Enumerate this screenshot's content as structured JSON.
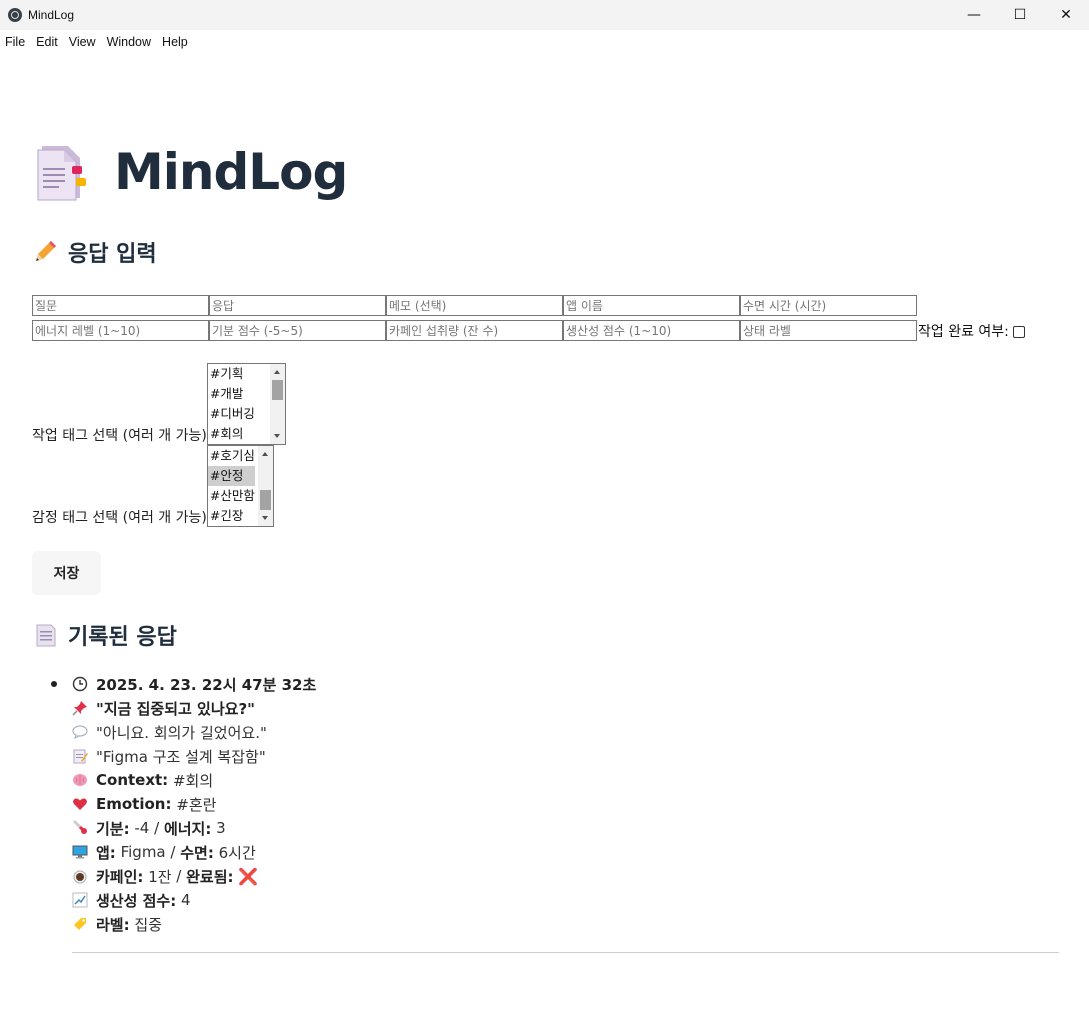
{
  "window": {
    "title": "MindLog",
    "min_glyph": "—",
    "max_glyph": "☐",
    "close_glyph": "✕"
  },
  "menu": [
    "File",
    "Edit",
    "View",
    "Window",
    "Help"
  ],
  "page": {
    "title": "MindLog",
    "title_icon": "memo-icon"
  },
  "input_section": {
    "heading": "응답 입력",
    "heading_icon": "pencil-icon",
    "row1": [
      "질문",
      "응답",
      "메모 (선택)",
      "앱 이름",
      "수면 시간 (시간)"
    ],
    "row2": [
      "에너지 레벨 (1~10)",
      "기분 점수 (-5~5)",
      "카페인 섭취량 (잔 수)",
      "생산성 점수 (1~10)",
      "상태 라벨"
    ],
    "done_label": "작업 완료 여부:",
    "done_checked": false,
    "work_tags_label": "작업 태그 선택 (여러 개 가능)",
    "work_tags_visible": [
      "#기획",
      "#개발",
      "#디버깅",
      "#회의"
    ],
    "emotion_tags_label": "감정 태그 선택 (여러 개 가능)",
    "emotion_tags_visible": [
      "#호기심",
      "#안정",
      "#산만함",
      "#긴장"
    ],
    "emotion_selected": "#안정",
    "save_label": "저장"
  },
  "records_section": {
    "heading": "기록된 응답",
    "heading_icon": "document-icon",
    "records": [
      {
        "timestamp": "2025. 4. 23. 22시 47분 32초",
        "question": "\"지금 집중되고 있나요?\"",
        "answer": "\"아니요. 회의가 길었어요.\"",
        "memo": "\"Figma 구조 설계 복잡함\"",
        "context_label": "Context:",
        "context_value": "#회의",
        "emotion_label": "Emotion:",
        "emotion_value": "#혼란",
        "mood_label": "기분:",
        "mood_value": "-4",
        "energy_label": "에너지:",
        "energy_value": "3",
        "app_label": "앱:",
        "app_value": "Figma",
        "sleep_label": "수면:",
        "sleep_value": "6시간",
        "caffeine_label": "카페인:",
        "caffeine_value": "1잔",
        "done_label": "완료됨:",
        "done_value": "❌",
        "productivity_label": "생산성 점수:",
        "productivity_value": "4",
        "status_label": "라벨:",
        "status_value": "집중"
      }
    ]
  },
  "colors": {
    "heading": "#1f2d3d",
    "titlebar": "#f3f3f3",
    "button_bg": "#f6f6f6",
    "cross": "#e0243a"
  }
}
